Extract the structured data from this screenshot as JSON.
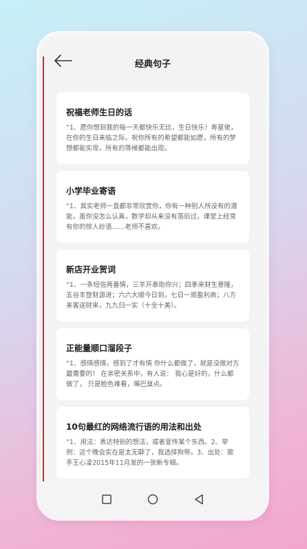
{
  "header": {
    "title": "经典句子"
  },
  "cards": [
    {
      "title": "祝福老师生日的话",
      "body": "“1、愿你想到我的每一天都快乐无比，生日快乐！寿星佬，在你的生日来临之际，祝你所有的希望都能如愿，所有的梦想都能实现，所有的等候都能出现。"
    },
    {
      "title": "小学毕业寄语",
      "body": "“1、其实老师一直都非常欣赏你，你有一种别人所没有的潜能，虽你没怎么认真，数学却从来没有落后过，课堂上经常有你的惊人妙语……老师不喜欢。"
    },
    {
      "title": "新店开业贺词",
      "body": "“1、一条短信两番情，三羊开泰助你兴；四季来财生意隆，五谷丰登财源进；六六大顺今日到，七日一周盈利高；八方来客送财来，九九归一实（十全十美）。"
    },
    {
      "title": "正能量顺口溜段子",
      "body": "“1、感情感情，感到了才有情 你什么都做了，就是没做对方最需要的！ 在亲密关系中，有人说： 我心是好的，什么都做了， 只是脸色难看，嘴巴臭点。"
    },
    {
      "title": "10句最红的网络流行语的用法和出处",
      "body": "“1、用法：表达特别的想法，或者宣传某个东西。2、举例：这个晚会实在是太无聊了，我选择狗带。3、出处：歌手王心凌2015年11月发的一张新专辑。"
    }
  ],
  "icons": {
    "back": "arrow-left-icon",
    "nav_recent": "square-icon",
    "nav_home": "circle-icon",
    "nav_back": "triangle-icon"
  },
  "colors": {
    "accent_line": "#b0303a"
  }
}
